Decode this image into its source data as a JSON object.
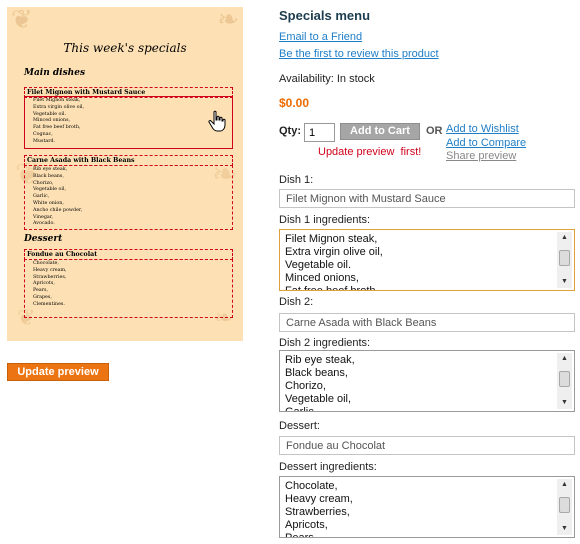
{
  "preview": {
    "title": "This week's specials",
    "section_main": "Main dishes",
    "section_dessert": "Dessert",
    "dish1_name": "Filet Mignon with Mustard Sauce",
    "dish1_ingredients": [
      "Filet Mignon steak,",
      "Extra virgin olive oil,",
      "Vegetable oil.",
      "Minced onions,",
      "Fat free beef broth,",
      "Cognac,",
      "Mustard."
    ],
    "dish2_name": "Carne Asada with Black Beans",
    "dish2_ingredients": [
      "Rib eye steak,",
      "Black beans,",
      "Chorizo,",
      "Vegetable oil,",
      "Garlic,",
      "White onion,",
      "Ancho chile powder,",
      "Vinegar,",
      "Avocado."
    ],
    "dessert_name": "Fondue au Chocolat",
    "dessert_ingredients": [
      "Chocolate,",
      "Heavy cream,",
      "Strawberries,",
      "Apricots,",
      "Pears,",
      "Grapes,",
      "Clementines."
    ]
  },
  "update_preview_label": "Update preview",
  "product": {
    "title": "Specials menu",
    "email_friend": "Email to a Friend",
    "review_link": "Be the first to review this product",
    "availability": "Availability: In stock",
    "price": "$0.00",
    "qty_label": "Qty:",
    "qty_value": "1",
    "add_to_cart": "Add to Cart",
    "or_label": "OR",
    "add_wishlist": "Add to Wishlist",
    "add_compare": "Add to Compare",
    "share_preview": "Share preview",
    "notice": "Update preview  first!"
  },
  "form": {
    "dish1_label": "Dish 1:",
    "dish1_value": "Filet Mignon with Mustard Sauce",
    "dish1_ingr_label": "Dish 1 ingredients:",
    "dish1_ingr_lines": [
      "Filet Mignon steak,",
      "Extra virgin olive oil,",
      "Vegetable oil.",
      "Minced onions,",
      "Fat free beef broth,"
    ],
    "dish2_label": "Dish 2:",
    "dish2_value": "Carne Asada with Black Beans",
    "dish2_ingr_label": "Dish 2 ingredients:",
    "dish2_ingr_lines": [
      "Rib eye steak,",
      "Black beans,",
      "Chorizo,",
      "Vegetable oil,",
      "Garlic,"
    ],
    "dessert_label": "Dessert:",
    "dessert_value": "Fondue au Chocolat",
    "dessert_ingr_label": "Dessert ingredients:",
    "dessert_ingr_lines": [
      "Chocolate,",
      "Heavy cream,",
      "Strawberries,",
      "Apricots,",
      "Pears,"
    ]
  },
  "icons": {
    "hand": "hand-cursor-icon",
    "scroll_up": "scroll-up-arrow-icon",
    "scroll_down": "scroll-down-arrow-icon",
    "resize_grip": "resize-grip-icon"
  },
  "colors": {
    "preview_bg": "#fde1b4",
    "dashed_border": "#d0021b",
    "link": "#1e7ec8",
    "price": "#ee6a00",
    "update_button": "#ed7412",
    "notice": "#d0021b"
  }
}
